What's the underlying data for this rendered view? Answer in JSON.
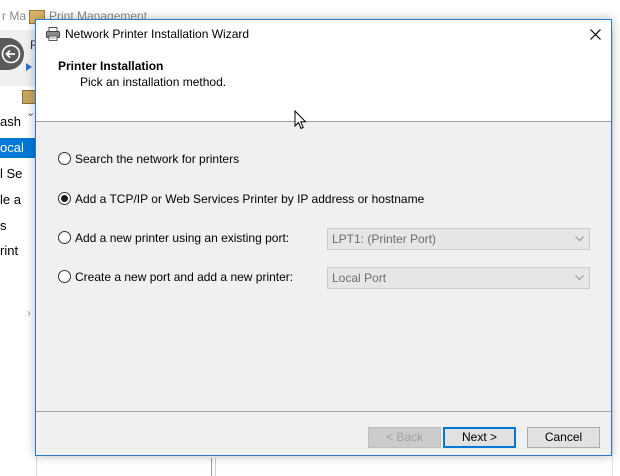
{
  "background_window": {
    "title_fragment_left": "r Ma",
    "title": "Print Management",
    "menu_fragment": "F",
    "tree_items": [
      {
        "label": "ash",
        "selected": false
      },
      {
        "label": "ocal",
        "selected": true
      },
      {
        "label": "l Se",
        "selected": false
      },
      {
        "label": "le a",
        "selected": false
      },
      {
        "label": "s",
        "selected": false
      },
      {
        "label": "rint",
        "selected": false
      }
    ]
  },
  "wizard": {
    "title": "Network Printer Installation Wizard",
    "header": {
      "title": "Printer Installation",
      "subtitle": "Pick an installation method."
    },
    "options": [
      {
        "label": "Search the network for printers",
        "checked": false
      },
      {
        "label": "Add a TCP/IP or Web Services Printer by IP address or hostname",
        "checked": true
      },
      {
        "label": "Add a new printer using an existing port:",
        "checked": false,
        "combo_value": "LPT1: (Printer Port)"
      },
      {
        "label": "Create a new port and add a new printer:",
        "checked": false,
        "combo_value": "Local Port"
      }
    ],
    "buttons": {
      "back": "< Back",
      "next": "Next >",
      "cancel": "Cancel"
    }
  },
  "colors": {
    "accent": "#0078d7",
    "dialog_border": "#2b79d0",
    "dialog_body": "#f0f0f0"
  },
  "icons": [
    "printer-icon",
    "close-icon",
    "chevron-down-icon",
    "back-arrow-icon",
    "mouse-cursor-icon"
  ]
}
